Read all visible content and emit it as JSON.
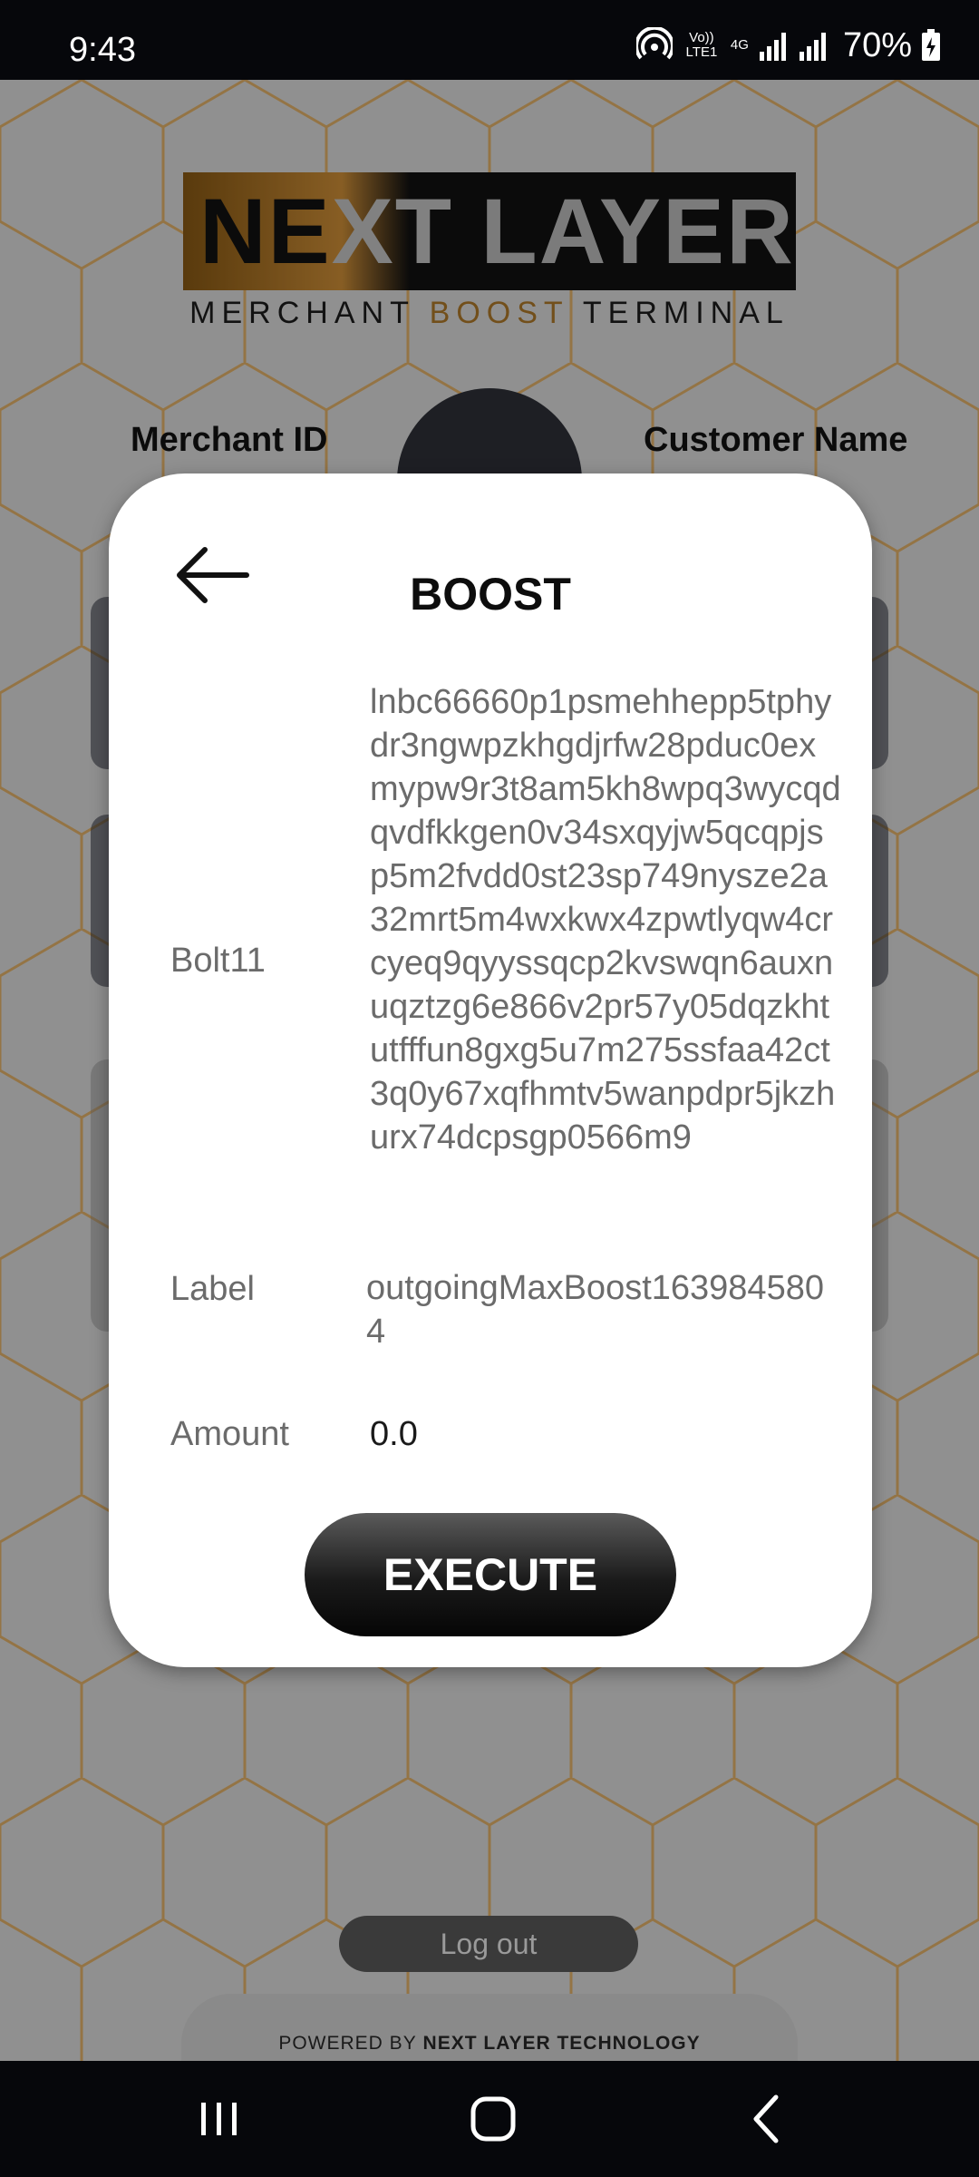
{
  "status_bar": {
    "time": "9:43",
    "volte": "Vo)) LTE1",
    "network": "4G",
    "battery": "70%",
    "icons": [
      "hotspot-icon",
      "signal-icon",
      "signal-icon",
      "battery-icon"
    ]
  },
  "background": {
    "logo": {
      "word_ne": "NE",
      "word_x": "X",
      "word_t": "T",
      "word_layer": "LAYER",
      "sub_merchant": "MERCHANT ",
      "sub_boost": "BOOST",
      "sub_terminal": " TERMINAL"
    },
    "merchant_id_label": "Merchant ID",
    "customer_name_label": "Customer Name",
    "logout_label": "Log out",
    "powered_prefix": "POWERED BY ",
    "powered_brand": "NEXT LAYER TECHNOLOGY"
  },
  "modal": {
    "title": "BOOST",
    "back_icon": "arrow-left-icon",
    "bolt11_label": "Bolt11",
    "bolt11_value": "lnbc66660p1psmehhepp5tphydr3ngwpzkhgdjrfw28pduc0exmypw9r3t8am5kh8wpq3wycqdqvdfkkgen0v34sxqyjw5qcqpjsp5m2fvdd0st23sp749nysze2a32mrt5m4wxkwx4zpwtlyqw4crcyeq9qyyssqcp2kvswqn6auxnuqztzg6e866v2pr57y05dqzkhtutfffun8gxg5u7m275ssfaa42ct3q0y67xqfhmtv5wanpdpr5jkzhurx74dcpsgp0566m9",
    "label_label": "Label",
    "label_value": "outgoingMaxBoost1639845804",
    "amount_label": "Amount",
    "amount_value": "0.0",
    "execute_label": "EXECUTE"
  },
  "nav_bar": {
    "icons": [
      "recents-icon",
      "home-icon",
      "back-icon"
    ]
  }
}
